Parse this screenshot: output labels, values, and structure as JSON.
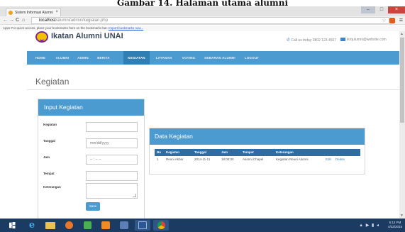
{
  "caption": "Gambar 14. Halaman utama alumni",
  "browser": {
    "tab_title": "Sistem Informasi Alumni",
    "tab_close": "×",
    "window_min": "–",
    "window_max": "□",
    "window_close": "×",
    "back": "←",
    "forward": "→",
    "reload": "C",
    "home": "⌂",
    "url_host": "localhost",
    "url_path": "/alumni/admin/kegiatan.php",
    "bookmarks_prefix": "Apps",
    "bookmarks_text": "For quick access, place your bookmarks here on the bookmarks bar.",
    "bookmarks_link": "Import bookmarks now..."
  },
  "site": {
    "name": "Ikatan Alumni UNAI",
    "contact_label": "Call us today 0802 123 4567",
    "email_label": "ikrqulumni@website.com"
  },
  "nav": {
    "items": [
      "HOME",
      "ALUMNI",
      "ADMIN",
      "BERITA",
      "KEGIATAN",
      "LAYANAN",
      "VOTING",
      "SEBARAN ALUMNI",
      "LOGOUT"
    ],
    "active": "KEGIATAN"
  },
  "page": {
    "heading": "Kegiatan"
  },
  "form": {
    "title": "Input Kegiatan",
    "fields": [
      {
        "label": "Kegiatan",
        "value": ""
      },
      {
        "label": "Tanggal",
        "placeholder": "mm/dd/yyyy"
      },
      {
        "label": "Jam",
        "placeholder": "-- : -- --"
      },
      {
        "label": "Tempat",
        "value": ""
      },
      {
        "label": "Keterangan",
        "value": ""
      }
    ],
    "save_label": "Save"
  },
  "data_table": {
    "title": "Data Kegiatan",
    "columns": [
      "No",
      "Kegiatan",
      "Tanggal",
      "Jam",
      "Tempat",
      "Keterangan",
      ""
    ],
    "rows": [
      {
        "no": "1",
        "kegiatan": "Reuni Akbar",
        "tanggal": "2014-11-11",
        "jam": "18:00:00",
        "tempat": "Alumni Chapel",
        "keterangan": "Kegiatan Reuni Alumni",
        "edit": "Edit",
        "delete": "Delete"
      }
    ]
  },
  "taskbar": {
    "tray_icons": "▲ ▶ ▮ ◂",
    "time": "5:12 PM",
    "date": "4/22/2015"
  },
  "colors": {
    "primary": "#4b9ad0",
    "nav_active": "#2f7fb5",
    "table_header": "#2e6da4",
    "taskbar": "#1c3b63"
  }
}
